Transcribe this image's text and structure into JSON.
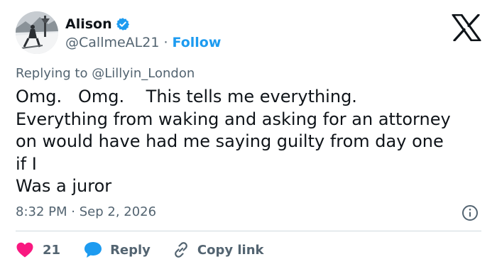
{
  "author": {
    "display_name": "Alison",
    "handle": "@CallmeAL21",
    "separator": "·",
    "follow_label": "Follow"
  },
  "reply_context": {
    "prefix": "Replying to ",
    "mention": "@Lillyin_London"
  },
  "tweet": {
    "text": "Omg.   Omg.    This tells me everything.\nEverything from waking and asking for an attorney\non would have had me saying guilty from day one\nif I\nWas a juror",
    "time": "8:32 PM",
    "separator": "·",
    "date": "Sep 2, 2026"
  },
  "actions": {
    "like_count": "21",
    "reply_label": "Reply",
    "copy_link_label": "Copy link"
  },
  "colors": {
    "accent": "#1d9bf0",
    "like": "#f91880",
    "text": "#0f1419",
    "secondary": "#536471",
    "divider": "#cfd9de"
  },
  "icons": {
    "verified": "verified-badge-icon",
    "brand": "x-logo-icon",
    "info": "info-icon",
    "like": "heart-icon",
    "reply": "speech-bubble-icon",
    "copy": "link-icon"
  }
}
